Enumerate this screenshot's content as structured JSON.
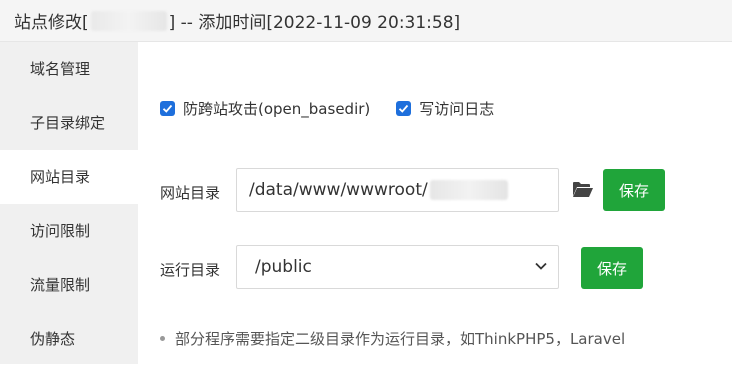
{
  "dialog": {
    "title_prefix": "站点修改[",
    "title_suffix": "] -- 添加时间[2022-11-09 20:31:58]"
  },
  "sidebar": {
    "items": [
      {
        "label": "域名管理"
      },
      {
        "label": "子目录绑定"
      },
      {
        "label": "网站目录"
      },
      {
        "label": "访问限制"
      },
      {
        "label": "流量限制"
      },
      {
        "label": "伪静态"
      }
    ],
    "active_index": 2
  },
  "options": {
    "open_basedir_label": "防跨站攻击(open_basedir)",
    "open_basedir_checked": true,
    "access_log_label": "写访问日志",
    "access_log_checked": true
  },
  "site_dir": {
    "label": "网站目录",
    "value": "/data/www/wwwroot/",
    "save_label": "保存"
  },
  "run_dir": {
    "label": "运行目录",
    "value": "/public",
    "save_label": "保存"
  },
  "note": "部分程序需要指定二级目录作为运行目录，如ThinkPHP5，Laravel",
  "colors": {
    "accent_green": "#20a53a",
    "checkbox_blue": "#1e6fdc",
    "sidebar_bg": "#f0f0f0"
  },
  "icons": [
    "folder-open-icon",
    "chevron-down-icon",
    "check-icon"
  ]
}
